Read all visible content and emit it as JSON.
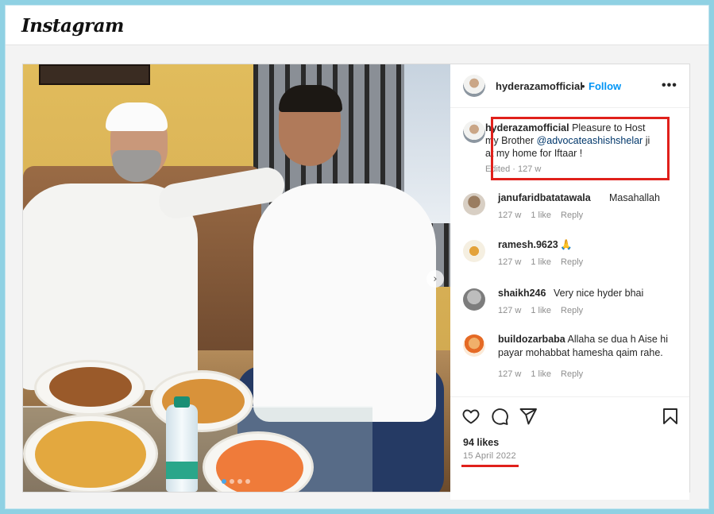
{
  "app": {
    "logo": "Instagram"
  },
  "post": {
    "author": "hyderazamofficial",
    "separator": "•",
    "follow_label": "Follow",
    "more_icon": "more-horizontal-icon",
    "caption": {
      "username": "hyderazamofficial",
      "text_before": "Pleasure to Host my Brother ",
      "mention": "@advocateashishshelar",
      "text_after": " ji at my home for Iftaar !",
      "meta": "Edited · 127 w"
    },
    "comments": [
      {
        "username": "janufaridbatatawala",
        "text": "Masahallah",
        "time": "127 w",
        "likes": "1 like",
        "reply": "Reply"
      },
      {
        "username": "ramesh.9623",
        "text": "🙏",
        "time": "127 w",
        "likes": "1 like",
        "reply": "Reply"
      },
      {
        "username": "shaikh246",
        "text": "Very nice hyder bhai",
        "time": "127 w",
        "likes": "1 like",
        "reply": "Reply"
      },
      {
        "username": "buildozarbaba",
        "text": "Allaha se dua h Aise hi payar mohabbat hamesha qaim rahe.",
        "time": "127 w",
        "likes": "1 like",
        "reply": "Reply"
      }
    ],
    "likes": "94 likes",
    "date": "15 April 2022",
    "carousel": {
      "current": 1,
      "total": 4
    }
  },
  "colors": {
    "accent": "#0095f6",
    "highlight": "#e0201b",
    "background": "#8fd1e3"
  }
}
